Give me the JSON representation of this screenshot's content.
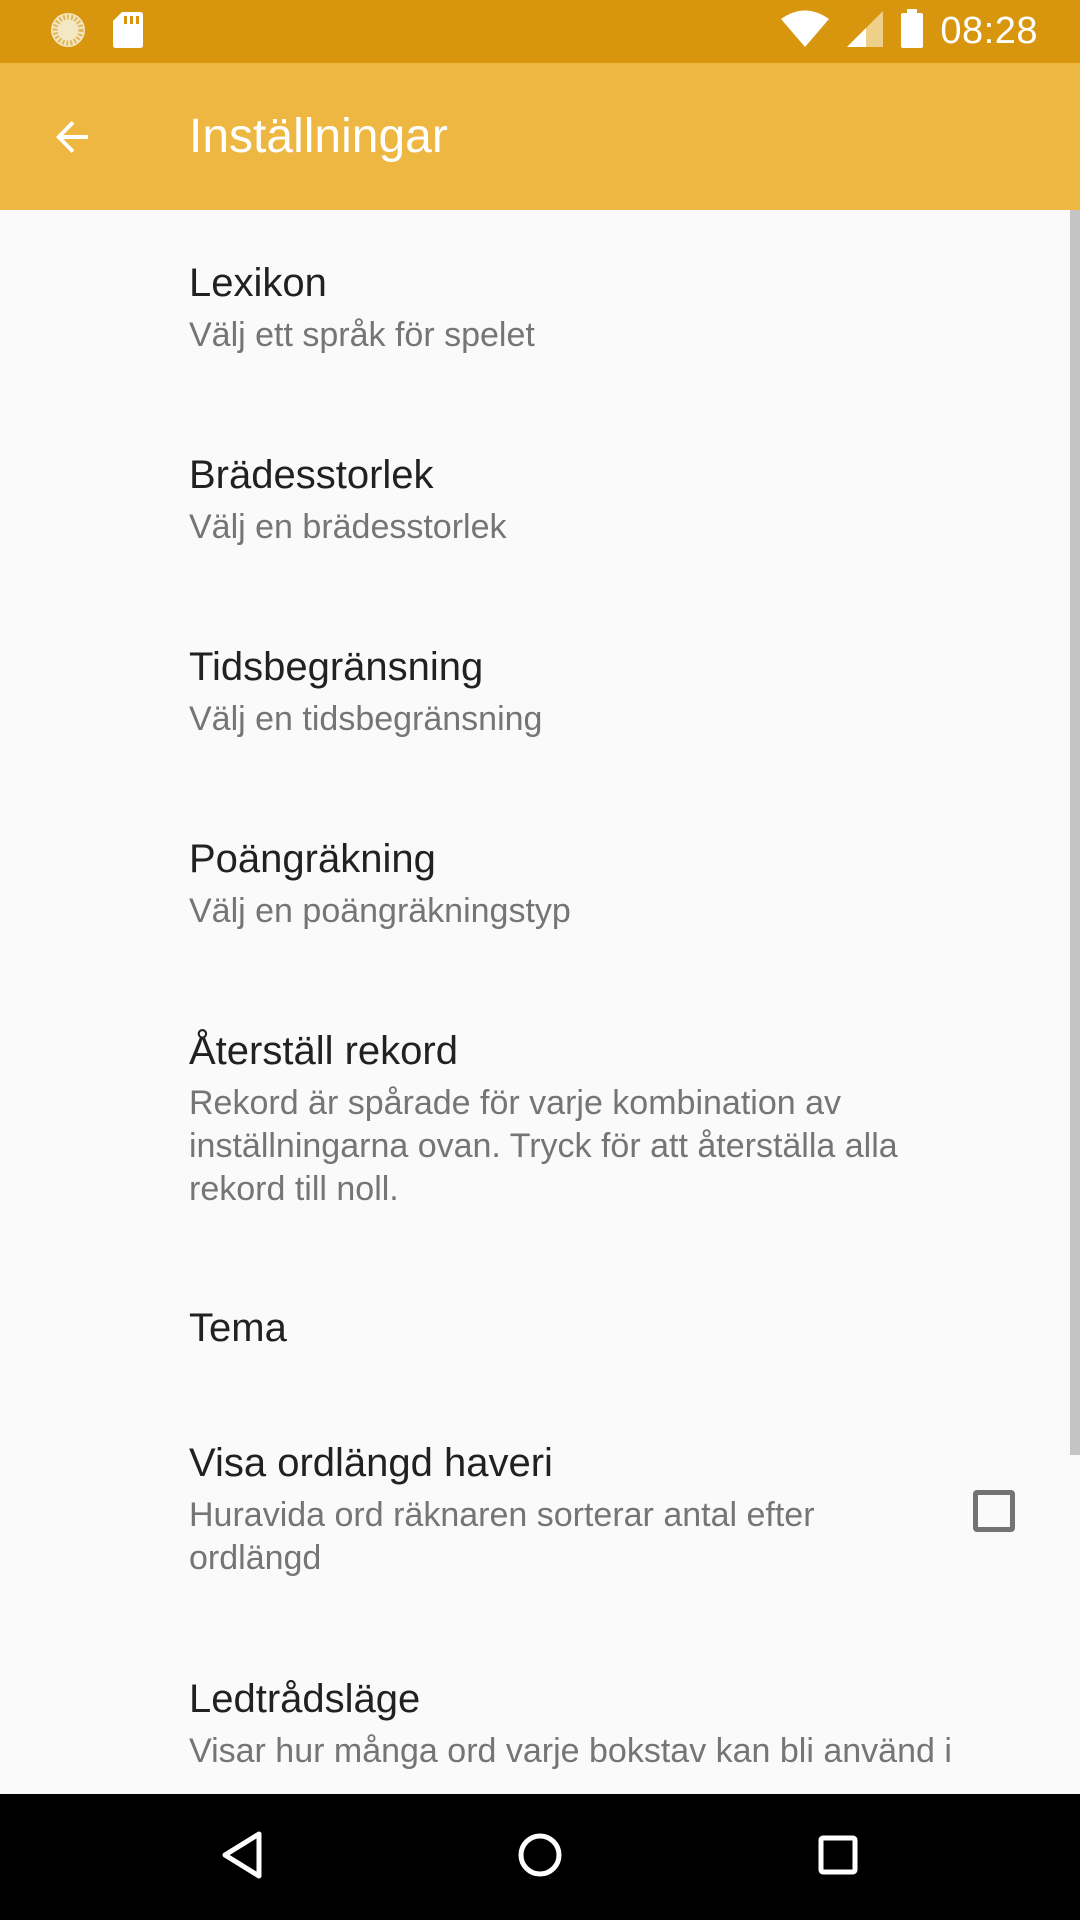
{
  "status_bar": {
    "time": "08:28",
    "left_icons": [
      "loading-circle-icon",
      "sd-card-icon"
    ],
    "right_icons": [
      "wifi-icon",
      "cellular-signal-icon",
      "battery-icon"
    ],
    "background_color": "#d8960f"
  },
  "app_bar": {
    "title": "Inställningar",
    "back_icon": "arrow-back-icon",
    "background_color": "#edb742"
  },
  "preferences": [
    {
      "title": "Lexikon",
      "summary": "Välj ett språk för spelet"
    },
    {
      "title": "Brädesstorlek",
      "summary": "Välj en brädesstorlek"
    },
    {
      "title": "Tidsbegränsning",
      "summary": "Välj en tidsbegränsning"
    },
    {
      "title": "Poängräkning",
      "summary": "Välj en poängräkningstyp"
    },
    {
      "title": "Återställ rekord",
      "summary": "Rekord är spårade för varje kombination av inställningarna ovan. Tryck för att återställa alla rekord till noll."
    },
    {
      "title": "Tema",
      "summary": ""
    },
    {
      "title": "Visa ordlängd haveri",
      "summary": "Huravida ord räknaren sorterar antal efter ordlängd",
      "checkbox_checked": false
    },
    {
      "title": "Ledtrådsläge",
      "summary": "Visar hur många ord varje bokstav kan bli använd i"
    }
  ],
  "nav_bar": {
    "icons": [
      "back-triangle-icon",
      "home-circle-icon",
      "recents-square-icon"
    ]
  }
}
